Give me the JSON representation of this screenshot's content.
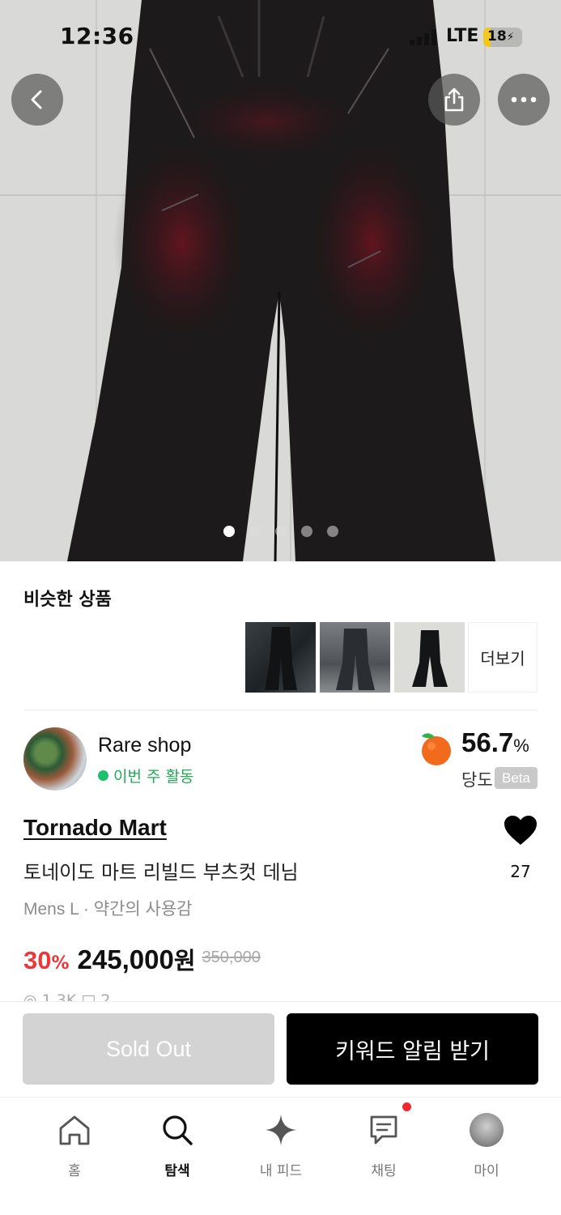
{
  "status_bar": {
    "time": "12:36",
    "network": "LTE",
    "battery": "18"
  },
  "hero": {
    "image_count": 5,
    "active_index": 0
  },
  "similar": {
    "title": "비슷한 상품",
    "more_label": "더보기"
  },
  "seller": {
    "name": "Rare shop",
    "activity": "이번 주 활동"
  },
  "sweetness": {
    "value": "56.7",
    "unit": "%",
    "label": "당도",
    "badge": "Beta"
  },
  "product": {
    "brand": "Tornado Mart",
    "name": "토네이도 마트 리빌드 부츠컷 데님",
    "condition": "Mens L · 약간의 사용감",
    "like_count": "27",
    "discount": "30",
    "discount_unit": "%",
    "price": "245,000",
    "price_unit": "원",
    "original_price": "350,000",
    "stats_partial": "◎ 1.3K  □ 2"
  },
  "actions": {
    "sold_out": "Sold Out",
    "keyword_alert": "키워드 알림 받기"
  },
  "tabs": [
    {
      "label": "홈"
    },
    {
      "label": "탐색"
    },
    {
      "label": "내 피드"
    },
    {
      "label": "채팅"
    },
    {
      "label": "마이"
    }
  ],
  "colors": {
    "accent_red": "#e83a3a",
    "active_green": "#1fc06a",
    "primary_black": "#000000",
    "disabled_gray": "#d3d3d3"
  }
}
